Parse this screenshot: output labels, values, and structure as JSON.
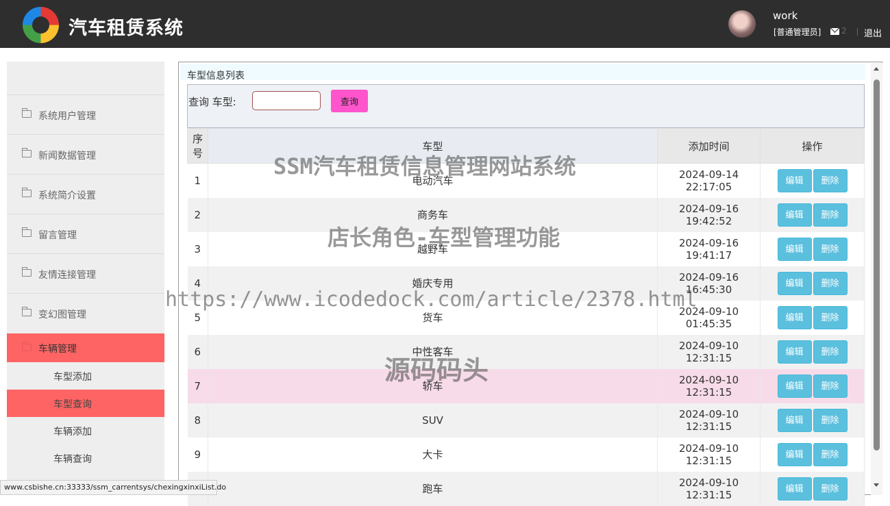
{
  "header": {
    "app_title": "汽车租赁系统",
    "user_name": "work",
    "user_role": "[普通管理员]",
    "mail_count": "2",
    "logout_label": "退出"
  },
  "sidebar": {
    "menu": [
      {
        "label": "系统用户管理",
        "active": false
      },
      {
        "label": "新闻数据管理",
        "active": false
      },
      {
        "label": "系统简介设置",
        "active": false
      },
      {
        "label": "留言管理",
        "active": false
      },
      {
        "label": "友情连接管理",
        "active": false
      },
      {
        "label": "变幻图管理",
        "active": false
      },
      {
        "label": "车辆管理",
        "active": true
      }
    ],
    "submenu": [
      {
        "label": "车型添加",
        "active": false
      },
      {
        "label": "车型查询",
        "active": true
      },
      {
        "label": "车辆添加",
        "active": false
      },
      {
        "label": "车辆查询",
        "active": false
      }
    ]
  },
  "main": {
    "panel_title": "车型信息列表",
    "search": {
      "label": "查询 车型:",
      "value": "",
      "button_label": "查询"
    },
    "table": {
      "headers": {
        "index": "序号",
        "type": "车型",
        "time": "添加时间",
        "ops": "操作"
      },
      "edit_label": "编辑",
      "delete_label": "删除",
      "rows": [
        {
          "index": "1",
          "type": "电动汽车",
          "time": "2024-09-14 22:17:05"
        },
        {
          "index": "2",
          "type": "商务车",
          "time": "2024-09-16 19:42:52"
        },
        {
          "index": "3",
          "type": "越野车",
          "time": "2024-09-16 19:41:17"
        },
        {
          "index": "4",
          "type": "婚庆专用",
          "time": "2024-09-16 16:45:30"
        },
        {
          "index": "5",
          "type": "货车",
          "time": "2024-09-10 01:45:35"
        },
        {
          "index": "6",
          "type": "中性客车",
          "time": "2024-09-10 12:31:15"
        },
        {
          "index": "7",
          "type": "轿车",
          "time": "2024-09-10 12:31:15"
        },
        {
          "index": "8",
          "type": "SUV",
          "time": "2024-09-10 12:31:15"
        },
        {
          "index": "9",
          "type": "大卡",
          "time": "2024-09-10 12:31:15"
        },
        {
          "index": "",
          "type": "跑车",
          "time": "2024-09-10 12:31:15"
        }
      ]
    }
  },
  "statusbar": {
    "url": "www.csbishe.cn:33333/ssm_carrentsys/chexingxinxiList.do"
  },
  "watermarks": {
    "line1": "SSM汽车租赁信息管理网站系统",
    "line2": "店长角色-车型管理功能",
    "line3": "https://www.icodedock.com/article/2378.html",
    "line4": "源码码头"
  }
}
